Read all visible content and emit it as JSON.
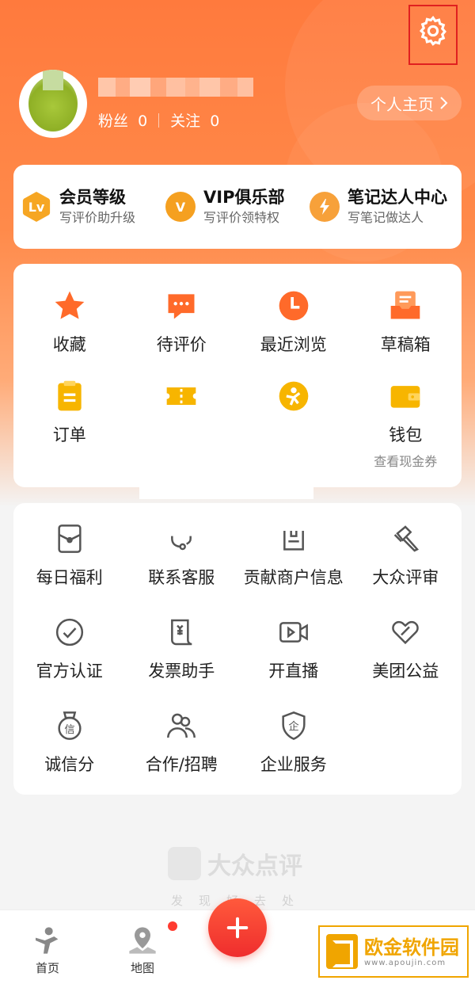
{
  "profile": {
    "fans_label": "粉丝",
    "fans_count": "0",
    "follow_label": "关注",
    "follow_count": "0",
    "homepage_label": "个人主页"
  },
  "member": [
    {
      "title": "会员等级",
      "sub": "写评价助升级",
      "badge": "Lv",
      "color": "#f6a623"
    },
    {
      "title": "VIP俱乐部",
      "sub": "写评价领特权",
      "badge": "V",
      "color": "#f5a020"
    },
    {
      "title": "笔记达人中心",
      "sub": "写笔记做达人",
      "badge": "",
      "color": "#f7a13a"
    }
  ],
  "main_grid": [
    {
      "label": "收藏",
      "icon": "star-icon"
    },
    {
      "label": "待评价",
      "icon": "comment-icon"
    },
    {
      "label": "最近浏览",
      "icon": "clock-icon"
    },
    {
      "label": "草稿箱",
      "icon": "draft-box-icon"
    },
    {
      "label": "订单",
      "icon": "order-icon"
    },
    {
      "label": "",
      "icon": "coupon-icon"
    },
    {
      "label": "",
      "icon": "points-icon"
    },
    {
      "label": "钱包",
      "sub": "查看现金券",
      "icon": "wallet-icon"
    }
  ],
  "more_grid": [
    {
      "label": "每日福利",
      "icon": "red-envelope-icon"
    },
    {
      "label": "联系客服",
      "icon": "headset-icon"
    },
    {
      "label": "贡献商户信息",
      "icon": "shop-icon"
    },
    {
      "label": "大众评审",
      "icon": "gavel-icon"
    },
    {
      "label": "官方认证",
      "icon": "check-circle-icon"
    },
    {
      "label": "发票助手",
      "icon": "invoice-icon"
    },
    {
      "label": "开直播",
      "icon": "video-camera-icon"
    },
    {
      "label": "美团公益",
      "icon": "charity-heart-icon"
    },
    {
      "label": "诚信分",
      "icon": "credit-badge-icon"
    },
    {
      "label": "合作/招聘",
      "icon": "people-icon"
    },
    {
      "label": "企业服务",
      "icon": "enterprise-shield-icon"
    }
  ],
  "brand": {
    "name": "大众点评",
    "slogan": "发现好去处"
  },
  "tabbar": {
    "home": "首页",
    "map": "地图"
  },
  "watermark": {
    "title": "欧金软件园",
    "url": "www.apoujin.com"
  },
  "colors": {
    "accent": "#ff7a3d",
    "icon_orange": "#ff6a2a",
    "icon_yellow": "#f7b500",
    "plus": "#ef2d2d"
  }
}
